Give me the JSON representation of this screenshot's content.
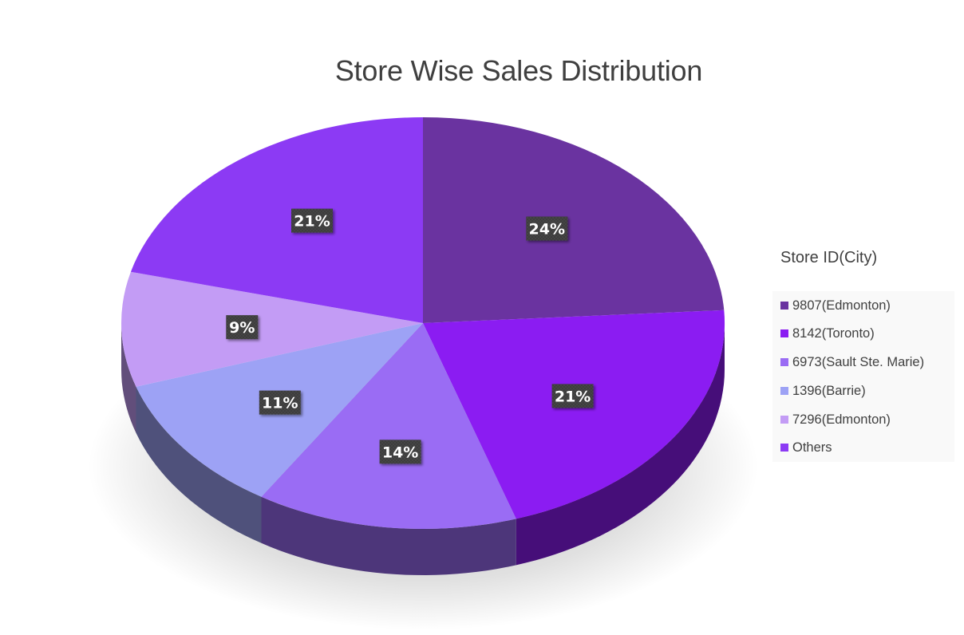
{
  "chart_data": {
    "type": "pie",
    "title": "Store Wise Sales Distribution",
    "legend_title": "Store ID(City)",
    "legend_position": "right",
    "categories": [
      "9807(Edmonton)",
      "8142(Toronto)",
      "6973(Sault Ste. Marie)",
      "1396(Barrie)",
      "7296(Edmonton)",
      "Others"
    ],
    "values": [
      24,
      21,
      14,
      11,
      9,
      21
    ],
    "data_labels": [
      "24%",
      "21%",
      "14%",
      "11%",
      "9%",
      "21%"
    ],
    "colors": [
      "#6a33a0",
      "#8b1cf2",
      "#9a6cf4",
      "#9da2f5",
      "#c39cf5",
      "#8c3af4"
    ],
    "style": "3d"
  }
}
